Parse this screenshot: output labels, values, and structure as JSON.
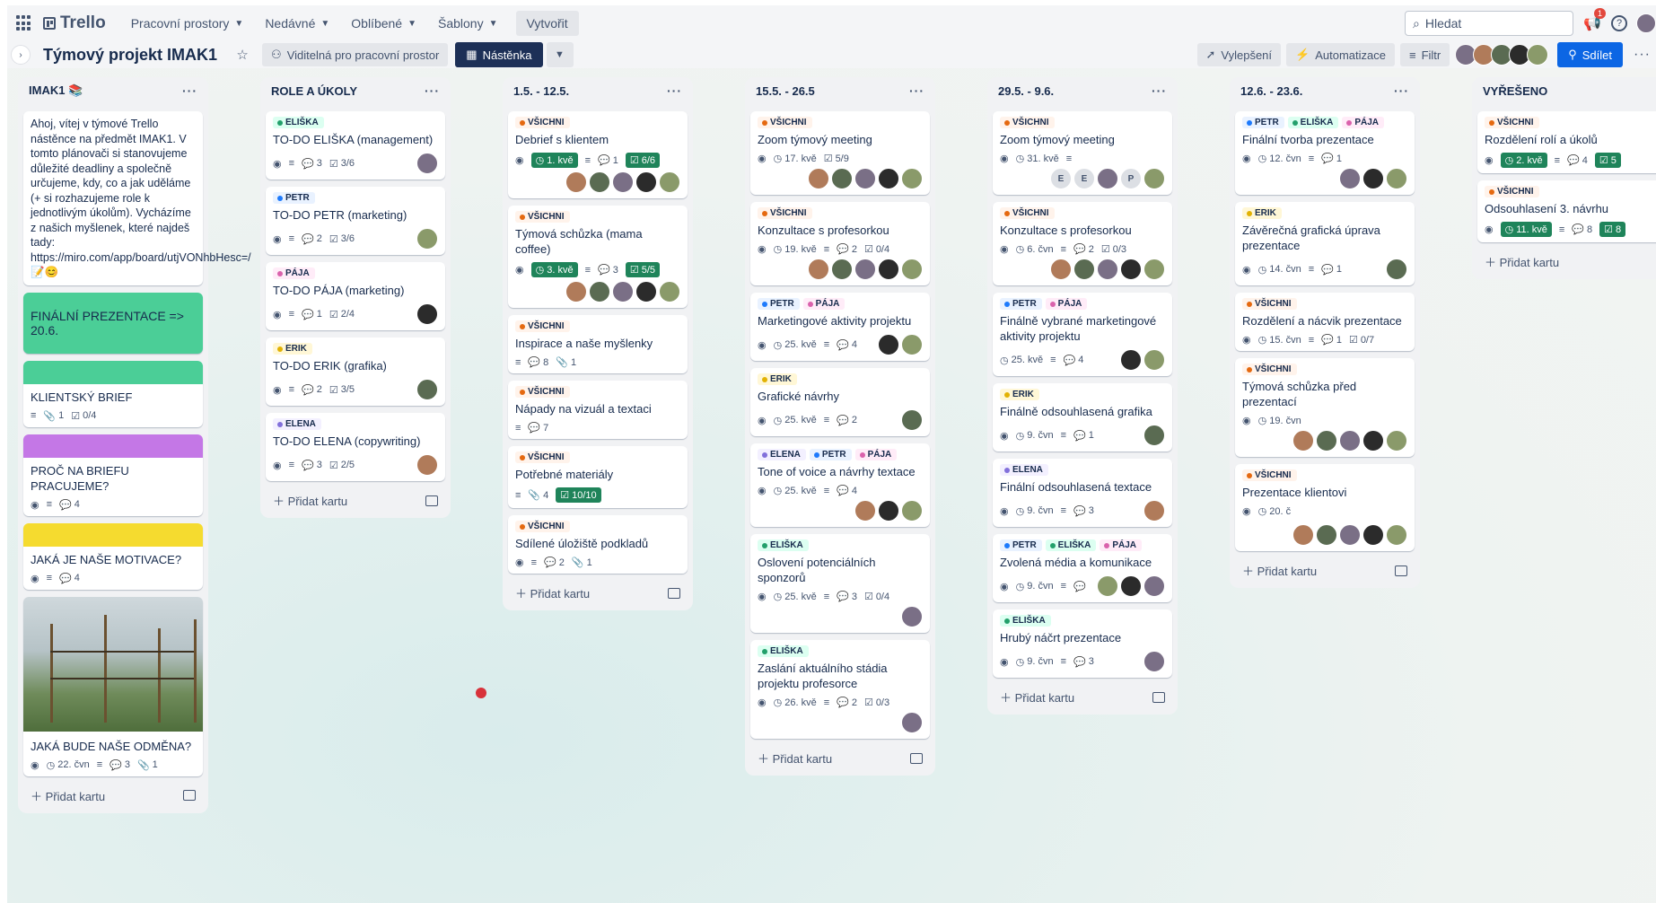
{
  "nav": {
    "logo": "Trello",
    "items": [
      {
        "label": "Pracovní prostory"
      },
      {
        "label": "Nedávné"
      },
      {
        "label": "Oblíbené"
      },
      {
        "label": "Šablony"
      }
    ],
    "create": "Vytvořit",
    "search_placeholder": "Hledat",
    "notifications_count": "1"
  },
  "header": {
    "title": "Týmový projekt IMAK1",
    "visibility": "Viditelná pro pracovní prostor",
    "view": "Nástěnka",
    "improvements": "Vylepšení",
    "automation": "Automatizace",
    "filter": "Filtr",
    "share": "Sdílet"
  },
  "lists": {
    "l0": {
      "title": "IMAK1 📚",
      "intro": "Ahoj, vítej v týmové Trello nástěnce na předmět IMAK1. V tomto plánovači si stanovujeme důležité deadliny a společně určujeme, kdy, co a jak uděláme (+ si rozhazujeme role k jednotlivým úkolům). Vycházíme z našich myšlenek, které najdeš tady: https://miro.com/app/board/utjVONhbHesc=/ 📝😊",
      "final": "FINÁLNÍ PREZENTACE => 20.6.",
      "c1": {
        "title": "KLIENTSKÝ BRIEF",
        "attach": "1",
        "check": "0/4"
      },
      "c2": {
        "title": "PROČ NA BRIEFU PRACUJEME?",
        "comments": "4"
      },
      "c3": {
        "title": "JAKÁ JE NAŠE MOTIVACE?",
        "comments": "4"
      },
      "c4": {
        "title": "JAKÁ BUDE NAŠE ODMĚNA?",
        "date": "22. čvn",
        "comments": "3",
        "attach": "1"
      },
      "add": "Přidat kartu"
    },
    "l1": {
      "title": "ROLE A ÚKOLY",
      "c1": {
        "label": "ELIŠKA",
        "title": "TO-DO ELIŠKA (management)",
        "comments": "3",
        "check": "3/6"
      },
      "c2": {
        "label": "PETR",
        "title": "TO-DO PETR (marketing)",
        "comments": "2",
        "check": "3/6"
      },
      "c3": {
        "label": "PÁJA",
        "title": "TO-DO PÁJA (marketing)",
        "comments": "1",
        "check": "2/4"
      },
      "c4": {
        "label": "ERIK",
        "title": "TO-DO ERIK (grafika)",
        "comments": "2",
        "check": "3/5"
      },
      "c5": {
        "label": "ELENA",
        "title": "TO-DO ELENA (copywriting)",
        "comments": "3",
        "check": "2/5"
      },
      "add": "Přidat kartu"
    },
    "l2": {
      "title": "1.5. - 12.5.",
      "c1": {
        "label": "VŠICHNI",
        "title": "Debrief s klientem",
        "date": "1. kvě",
        "comments": "1",
        "check": "6/6"
      },
      "c2": {
        "label": "VŠICHNI",
        "title": "Týmová schůzka (mama coffee)",
        "date": "3. kvě",
        "comments": "3",
        "check": "5/5"
      },
      "c3": {
        "label": "VŠICHNI",
        "title": "Inspirace a naše myšlenky",
        "comments": "8",
        "attach": "1"
      },
      "c4": {
        "label": "VŠICHNI",
        "title": "Nápady na vizuál a textaci",
        "comments": "7"
      },
      "c5": {
        "label": "VŠICHNI",
        "title": "Potřebné materiály",
        "attach": "4",
        "check": "10/10"
      },
      "c6": {
        "label": "VŠICHNI",
        "title": "Sdílené úložiště podkladů",
        "comments": "2",
        "attach": "1"
      },
      "add": "Přidat kartu"
    },
    "l3": {
      "title": "15.5. - 26.5",
      "c1": {
        "label": "VŠICHNI",
        "title": "Zoom týmový meeting",
        "date": "17. kvě",
        "check": "5/9"
      },
      "c2": {
        "label": "VŠICHNI",
        "title": "Konzultace s profesorkou",
        "date": "19. kvě",
        "comments": "2",
        "check": "0/4"
      },
      "c3": {
        "label1": "PETR",
        "label2": "PÁJA",
        "title": "Marketingové aktivity projektu",
        "date": "25. kvě",
        "comments": "4"
      },
      "c4": {
        "label": "ERIK",
        "title": "Grafické návrhy",
        "date": "25. kvě",
        "comments": "2"
      },
      "c5": {
        "label1": "ELENA",
        "label2": "PETR",
        "label3": "PÁJA",
        "title": "Tone of voice a návrhy textace",
        "date": "25. kvě",
        "comments": "4"
      },
      "c6": {
        "label": "ELIŠKA",
        "title": "Oslovení potenciálních sponzorů",
        "date": "25. kvě",
        "comments": "3",
        "check": "0/4"
      },
      "c7": {
        "label": "ELIŠKA",
        "title": "Zaslání aktuálního stádia projektu profesorce",
        "date": "26. kvě",
        "comments": "2",
        "check": "0/3"
      },
      "add": "Přidat kartu"
    },
    "l4": {
      "title": "29.5. - 9.6.",
      "c1": {
        "label": "VŠICHNI",
        "title": "Zoom týmový meeting",
        "date": "31. kvě"
      },
      "c2": {
        "label": "VŠICHNI",
        "title": "Konzultace s profesorkou",
        "date": "6. čvn",
        "comments": "2",
        "check": "0/3"
      },
      "c3": {
        "label1": "PETR",
        "label2": "PÁJA",
        "title": "Finálně vybrané marketingové aktivity projektu",
        "date": "25. kvě",
        "comments": "4"
      },
      "c4": {
        "label": "ERIK",
        "title": "Finálně odsouhlasená grafika",
        "date": "9. čvn",
        "comments": "1"
      },
      "c5": {
        "label": "ELENA",
        "title": "Finální odsouhlasená textace",
        "date": "9. čvn",
        "comments": "3"
      },
      "c6": {
        "label1": "PETR",
        "label2": "ELIŠKA",
        "label3": "PÁJA",
        "title": "Zvolená média a komunikace",
        "date": "9. čvn"
      },
      "c7": {
        "label": "ELIŠKA",
        "title": "Hrubý náčrt prezentace",
        "date": "9. čvn",
        "comments": "3"
      },
      "add": "Přidat kartu"
    },
    "l5": {
      "title": "12.6. - 23.6.",
      "c1": {
        "label1": "PETR",
        "label2": "ELIŠKA",
        "label3": "PÁJA",
        "title": "Finální tvorba prezentace",
        "date": "12. čvn",
        "comments": "1"
      },
      "c2": {
        "label": "ERIK",
        "title": "Závěrečná grafická úprava prezentace",
        "date": "14. čvn",
        "comments": "1"
      },
      "c3": {
        "label": "VŠICHNI",
        "title": "Rozdělení a nácvik prezentace",
        "date": "15. čvn",
        "comments": "1",
        "check": "0/7"
      },
      "c4": {
        "label": "VŠICHNI",
        "title": "Týmová schůzka před prezentací",
        "date": "19. čvn"
      },
      "c5": {
        "label": "VŠICHNI",
        "title": "Prezentace klientovi",
        "date": "20. č"
      },
      "add": "Přidat kartu"
    },
    "l6": {
      "title": "VYŘEŠENO",
      "c1": {
        "label": "VŠICHNI",
        "title": "Rozdělení rolí a úkolů",
        "date": "2. kvě",
        "comments": "4",
        "check": "5"
      },
      "c2": {
        "label": "VŠICHNI",
        "title": "Odsouhlasení 3. návrhu",
        "date": "11. kvě",
        "comments": "8",
        "check": "8"
      },
      "add": "Přidat kartu"
    }
  },
  "avatar_initials": {
    "e": "E",
    "p": "P"
  },
  "colors": {
    "vsichni": "#f5cd47",
    "eliska": "#4bce97",
    "petr": "#579dff",
    "paja": "#e774bb",
    "erik": "#f5cd47",
    "elena": "#9f8fef",
    "due_done": "#1f845a",
    "share": "#0c66e4"
  }
}
